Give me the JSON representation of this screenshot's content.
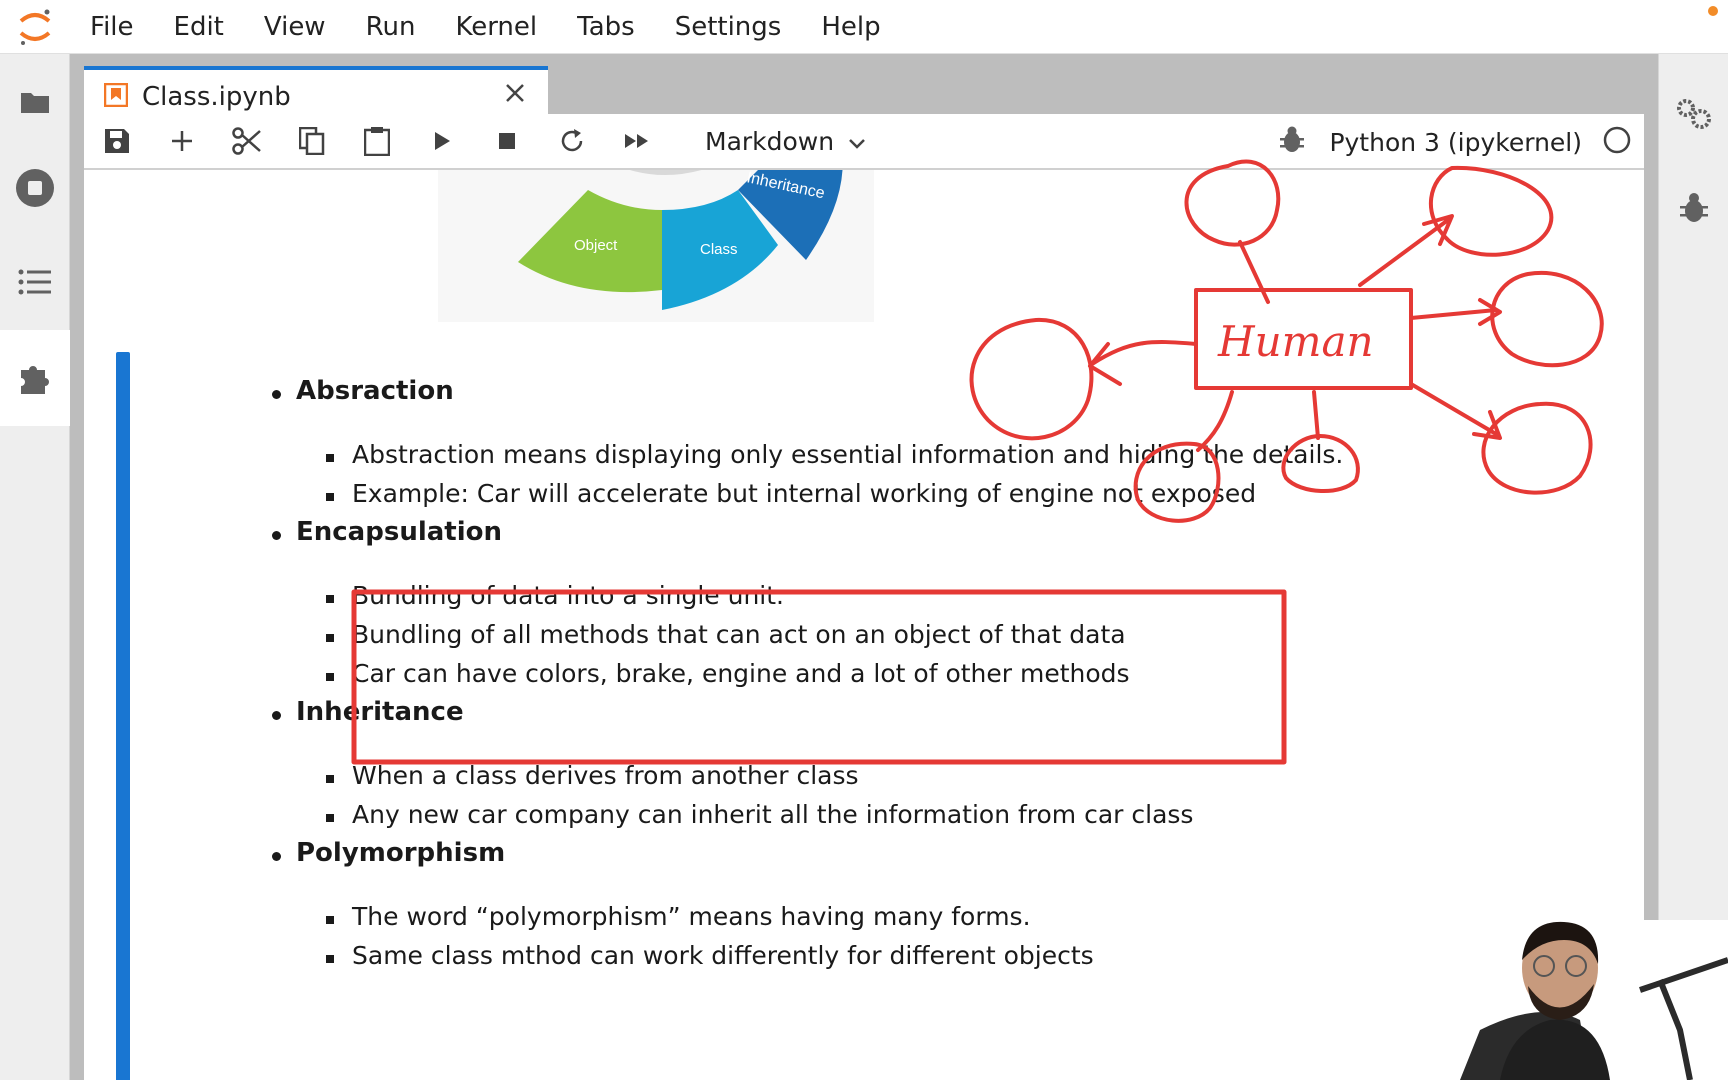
{
  "menu": {
    "items": [
      "File",
      "Edit",
      "View",
      "Run",
      "Kernel",
      "Tabs",
      "Settings",
      "Help"
    ]
  },
  "left_sidebar": {
    "icons": [
      "folder-icon",
      "running-icon",
      "toc-icon",
      "extension-icon"
    ]
  },
  "right_sidebar": {
    "icons": [
      "property-inspector-icon",
      "debugger-icon"
    ]
  },
  "tab": {
    "title": "Class.ipynb"
  },
  "toolbar": {
    "cell_type": "Markdown",
    "kernel": "Python 3 (ipykernel)",
    "buttons": [
      "save",
      "insert",
      "cut",
      "copy",
      "paste",
      "run",
      "interrupt",
      "restart",
      "run-all"
    ]
  },
  "image": {
    "segments": [
      "Object",
      "Class",
      "Inheritance"
    ]
  },
  "notebook": {
    "sections": [
      {
        "title": "Absraction",
        "items": [
          "Abstraction means displaying only essential information and hiding the details.",
          "Example: Car will accelerate but internal working of engine not exposed"
        ]
      },
      {
        "title": "Encapsulation",
        "items": [
          "Bundling of data into a single unit.",
          "Bundling of all methods that can act on an object of that data",
          "Car can have colors, brake, engine and a lot of other methods"
        ]
      },
      {
        "title": "Inheritance",
        "items": [
          "When a class derives from another class",
          "Any new car company can inherit all the information from car class"
        ]
      },
      {
        "title": "Polymorphism",
        "items": [
          "The word “polymorphism” means having many forms.",
          "Same class mthod can work differently for different objects"
        ]
      }
    ]
  },
  "annotation": {
    "center_label": "Human",
    "color": "#e53935"
  },
  "colors": {
    "accent": "#1976d2",
    "logo": "#f37726"
  }
}
